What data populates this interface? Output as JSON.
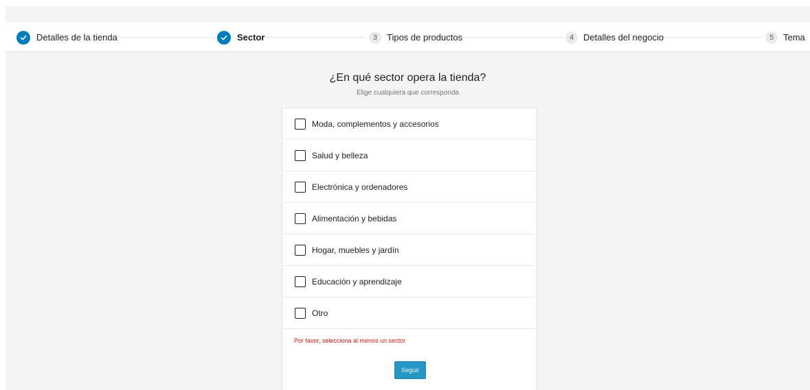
{
  "stepper": {
    "steps": [
      {
        "number": "",
        "label": "Detalles de la tienda",
        "state": "completed"
      },
      {
        "number": "",
        "label": "Sector",
        "state": "current"
      },
      {
        "number": "3",
        "label": "Tipos de productos",
        "state": "pending"
      },
      {
        "number": "4",
        "label": "Detalles del negocio",
        "state": "pending"
      },
      {
        "number": "5",
        "label": "Tema",
        "state": "pending"
      }
    ]
  },
  "main": {
    "title": "¿En qué sector opera la tienda?",
    "subtitle": "Elige cualquiera que corresponda",
    "options": [
      {
        "label": "Moda, complementos y accesorios",
        "checked": false
      },
      {
        "label": "Salud y belleza",
        "checked": false
      },
      {
        "label": "Electrónica y ordenadores",
        "checked": false
      },
      {
        "label": "Alimentación y bebidas",
        "checked": false
      },
      {
        "label": "Hogar, muebles y jardín",
        "checked": false
      },
      {
        "label": "Educación y aprendizaje",
        "checked": false
      },
      {
        "label": "Otro",
        "checked": false
      }
    ],
    "error": "Por favor, selecciona al menos un sector",
    "continue_label": "Seguir"
  },
  "colors": {
    "accent": "#007cba",
    "error": "#cc1818",
    "background": "#f3f4f5"
  },
  "icons": {
    "completed_step": "checkmark-icon"
  }
}
